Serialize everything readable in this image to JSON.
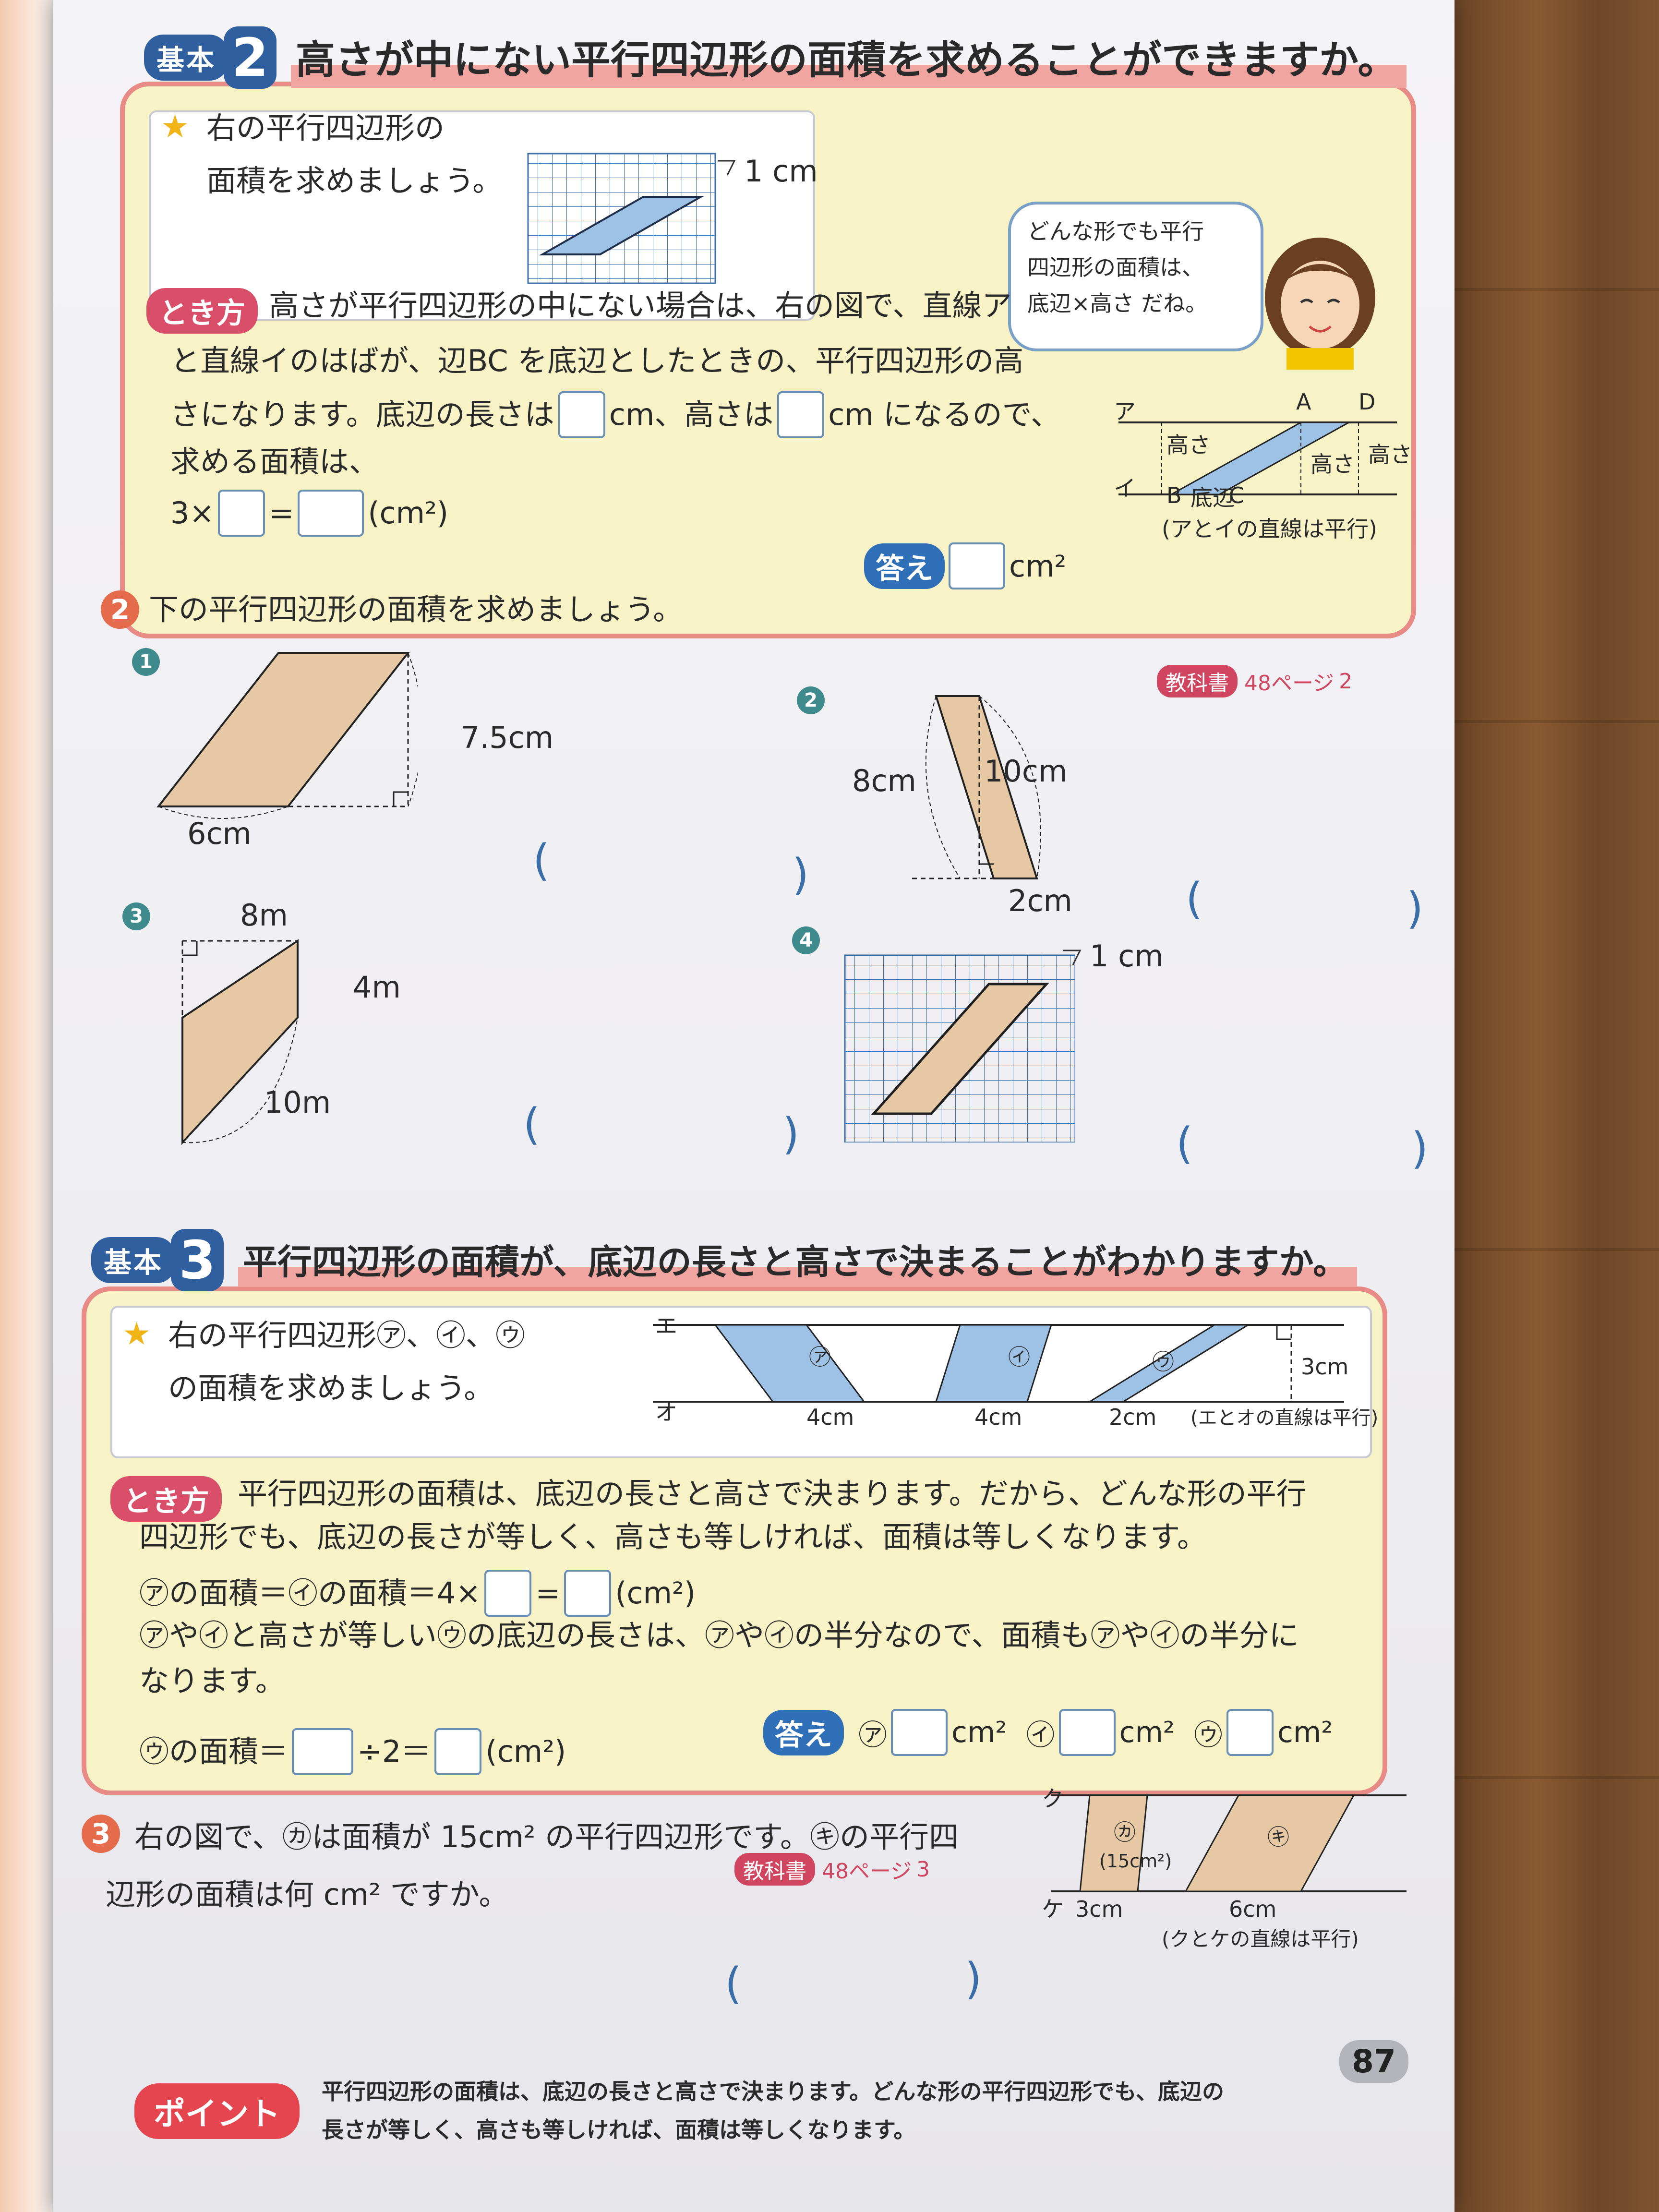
{
  "section2": {
    "badge": "基本",
    "number": "2",
    "title": "高さが中にない平行四辺形の面積を求めることができますか。",
    "problem_line1": "右の平行四辺形の",
    "problem_line2": "面積を求めましょう。",
    "grid_unit": "1 cm",
    "speech_line1": "どんな形でも平行",
    "speech_line2": "四辺形の面積は、",
    "speech_line3": "底辺×高さ だね。",
    "tokikata": "とき方",
    "exp_line1": "高さが平行四辺形の中にない場合は、右の図で、直線ア",
    "exp_line2": "と直線イのはばが、辺BC を底辺としたときの、平行四辺形の高",
    "exp_line3a": "さになります。底辺の長さは",
    "exp_line3b": "cm、高さは",
    "exp_line3c": "cm になるので、",
    "exp_line4": "求める面積は、",
    "formula_a": "3×",
    "formula_eq": "=",
    "formula_unit": "(cm²)",
    "answer_badge": "答え",
    "answer_unit": "cm²",
    "fig_labels": {
      "a": "ア",
      "i": "イ",
      "A": "A",
      "D": "D",
      "B": "B",
      "C": "C",
      "h1": "高さ",
      "h2": "高さ",
      "h3": "高さ",
      "base": "底辺",
      "note": "(アとイの直線は平行)"
    }
  },
  "exercise2": {
    "number": "2",
    "prompt": "下の平行四辺形の面積を求めましょう。",
    "textbook": "教科書",
    "textbook_ref": "48ページ",
    "textbook_mark": "2",
    "q1": {
      "num": "1",
      "height": "7.5cm",
      "base": "6cm"
    },
    "q2": {
      "num": "2",
      "left": "8cm",
      "right": "10cm",
      "base": "2cm"
    },
    "q3": {
      "num": "3",
      "top": "8m",
      "right": "4m",
      "bottom": "10m"
    },
    "q4": {
      "num": "4",
      "unit": "1 cm"
    },
    "paren_open": "(",
    "paren_close": ")"
  },
  "section3": {
    "badge": "基本",
    "number": "3",
    "title": "平行四辺形の面積が、底辺の長さと高さで決まることがわかりますか。",
    "problem_line1": "右の平行四辺形㋐、㋑、㋒",
    "problem_line2": "の面積を求めましょう。",
    "fig": {
      "e": "エ",
      "o": "オ",
      "a": "㋐",
      "i": "㋑",
      "u": "㋒",
      "b1": "4cm",
      "b2": "4cm",
      "b3": "2cm",
      "h": "3cm",
      "note": "(エとオの直線は平行)"
    },
    "tokikata": "とき方",
    "exp_line1": "平行四辺形の面積は、底辺の長さと高さで決まります。だから、どんな形の平行",
    "exp_line2": "四辺形でも、底辺の長さが等しく、高さも等しければ、面積は等しくなります。",
    "exp_line3a": "㋐の面積＝㋑の面積＝4×",
    "exp_line3b": "=",
    "exp_line3c": "(cm²)",
    "exp_line4": "㋐や㋑と高さが等しい㋒の底辺の長さは、㋐や㋑の半分なので、面積も㋐や㋑の半分に",
    "exp_line5": "なります。",
    "exp_line6a": "㋒の面積＝",
    "exp_line6b": "÷2＝",
    "exp_line6c": "(cm²)",
    "answer_badge": "答え",
    "ans_a": "㋐",
    "ans_i": "㋑",
    "ans_u": "㋒",
    "ans_unit": "cm²"
  },
  "exercise3": {
    "number": "3",
    "line1": "右の図で、㋕は面積が 15cm² の平行四辺形です。㋖の平行四",
    "line2": "辺形の面積は何 cm² ですか。",
    "textbook": "教科書",
    "textbook_ref": "48ページ",
    "textbook_mark": "3",
    "fig": {
      "ku": "ク",
      "ke": "ケ",
      "ka": "㋕",
      "ka_area": "(15cm²)",
      "ki": "㋖",
      "b1": "3cm",
      "b2": "6cm",
      "note": "(クとケの直線は平行)"
    }
  },
  "point": {
    "label": "ポイント",
    "line1": "平行四辺形の面積は、底辺の長さと高さで決まります。どんな形の平行四辺形でも、底辺の",
    "line2": "長さが等しく、高さも等しければ、面積は等しくなります。"
  },
  "page_number": "87",
  "colors": {
    "panel_bg": "#f8f3c6",
    "panel_border": "#e88a86",
    "badge_blue": "#2f5f9e",
    "shape_tan": "#e6c9a4",
    "shape_blue": "#9ec2e6"
  }
}
